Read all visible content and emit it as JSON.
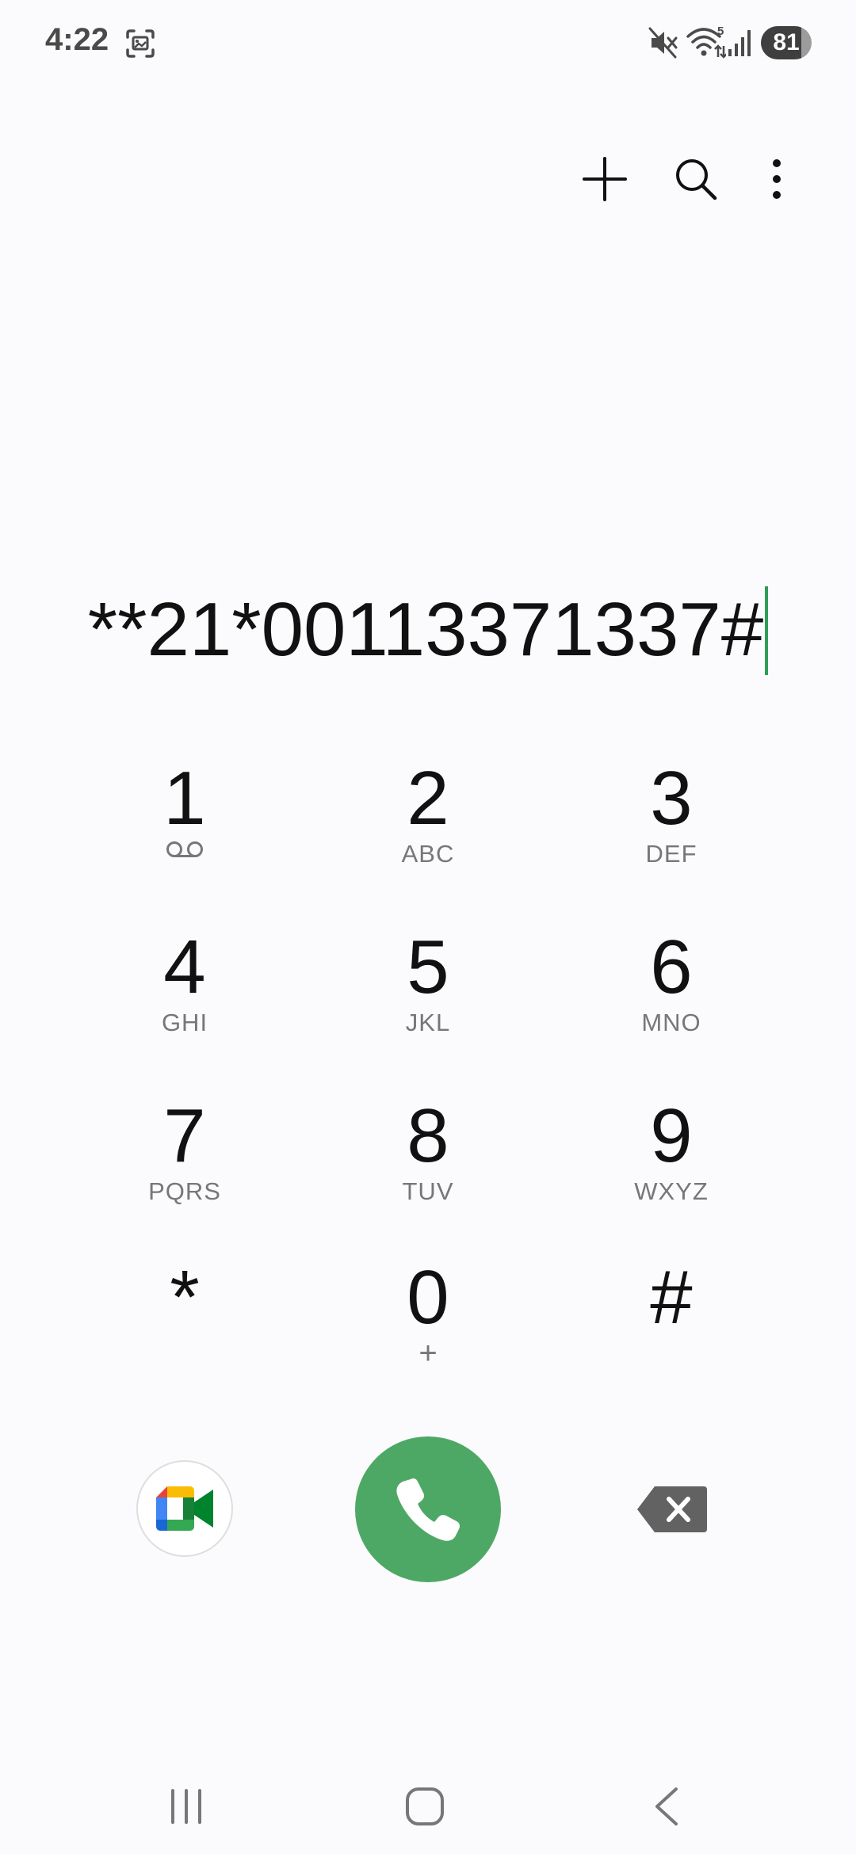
{
  "status_bar": {
    "time": "4:22",
    "battery": "81"
  },
  "toolbar": {
    "icons": [
      "plus-icon",
      "search-icon",
      "more-vertical-icon"
    ]
  },
  "dialer": {
    "number": "**21*00113371337#"
  },
  "keypad": {
    "keys": [
      {
        "digit": "1",
        "letters": ""
      },
      {
        "digit": "2",
        "letters": "ABC"
      },
      {
        "digit": "3",
        "letters": "DEF"
      },
      {
        "digit": "4",
        "letters": "GHI"
      },
      {
        "digit": "5",
        "letters": "JKL"
      },
      {
        "digit": "6",
        "letters": "MNO"
      },
      {
        "digit": "7",
        "letters": "PQRS"
      },
      {
        "digit": "8",
        "letters": "TUV"
      },
      {
        "digit": "9",
        "letters": "WXYZ"
      },
      {
        "digit": "*",
        "letters": ""
      },
      {
        "digit": "0",
        "letters": "+"
      },
      {
        "digit": "#",
        "letters": ""
      }
    ]
  },
  "colors": {
    "call_button": "#4ea865",
    "caret": "#2e9e57",
    "background": "#fbfbfd"
  }
}
